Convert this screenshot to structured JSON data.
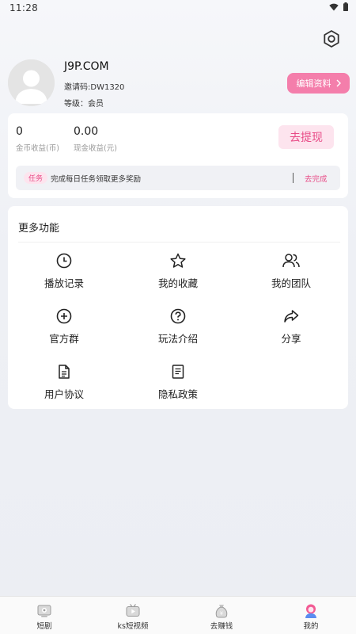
{
  "status": {
    "time": "11:28"
  },
  "profile": {
    "name": "J9P.COM",
    "invite_code": "邀请码:DW1320",
    "level": "等级：会员",
    "edit_label": "编辑资料"
  },
  "earnings": {
    "coins_value": "0",
    "coins_label": "金币收益(币)",
    "cash_value": "0.00",
    "cash_label": "现金收益(元)",
    "withdraw_label": "去提现"
  },
  "task": {
    "tag": "任务",
    "text": "完成每日任务领取更多奖励",
    "action": "去完成"
  },
  "functions": {
    "title": "更多功能",
    "items": [
      {
        "label": "播放记录",
        "icon": "clock-icon"
      },
      {
        "label": "我的收藏",
        "icon": "star-icon"
      },
      {
        "label": "我的团队",
        "icon": "team-icon"
      },
      {
        "label": "官方群",
        "icon": "plus-circle-icon"
      },
      {
        "label": "玩法介绍",
        "icon": "help-icon"
      },
      {
        "label": "分享",
        "icon": "share-icon"
      },
      {
        "label": "用户协议",
        "icon": "document-icon"
      },
      {
        "label": "隐私政策",
        "icon": "policy-icon"
      }
    ]
  },
  "nav": {
    "items": [
      {
        "label": "短剧",
        "icon": "drama-icon"
      },
      {
        "label": "ks短视频",
        "icon": "video-icon"
      },
      {
        "label": "去赚钱",
        "icon": "money-bag-icon"
      },
      {
        "label": "我的",
        "icon": "profile-icon",
        "active": true
      }
    ]
  },
  "colors": {
    "accent": "#f47eab",
    "accent_text": "#e84c87",
    "accent_bg": "#fde4ee"
  }
}
